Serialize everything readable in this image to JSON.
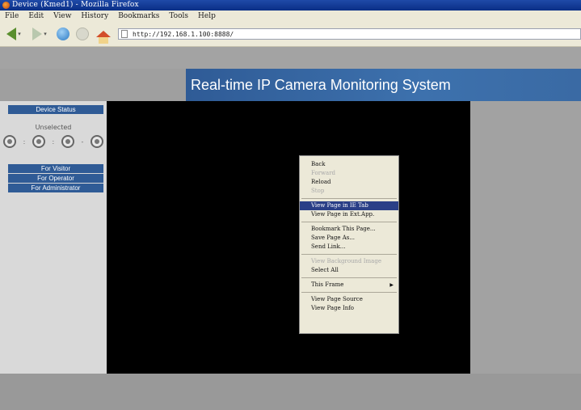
{
  "window": {
    "title": "Device (Kmed1) - Mozilla Firefox"
  },
  "menubar": [
    "File",
    "Edit",
    "View",
    "History",
    "Bookmarks",
    "Tools",
    "Help"
  ],
  "navbar": {
    "url": "http://192.168.1.100:8888/"
  },
  "header": {
    "banner": "Real-time IP Camera Monitoring System"
  },
  "sidebar": {
    "device_status_label": "Device Status",
    "status_text": "Unselected",
    "camera_icons": [
      "camera-icon",
      "camera-icon",
      "camera-icon",
      "camera-icon"
    ],
    "separators": [
      ":",
      ":",
      "-"
    ],
    "visitor_label": "For Visitor",
    "operator_label": "For Operator",
    "admin_label": "For Administrator"
  },
  "context_menu": {
    "back": "Back",
    "forward": "Forward",
    "reload": "Reload",
    "stop": "Stop",
    "view_new_tab": "View Page in IE Tab",
    "view_ext_app": "View Page in Ext.App.",
    "bookmark": "Bookmark This Page...",
    "save_page": "Save Page As...",
    "send_link": "Send Link...",
    "view_bg": "View Background Image",
    "select_all": "Select All",
    "this_frame": "This Frame",
    "view_source": "View Page Source",
    "view_info": "View Page Info"
  }
}
